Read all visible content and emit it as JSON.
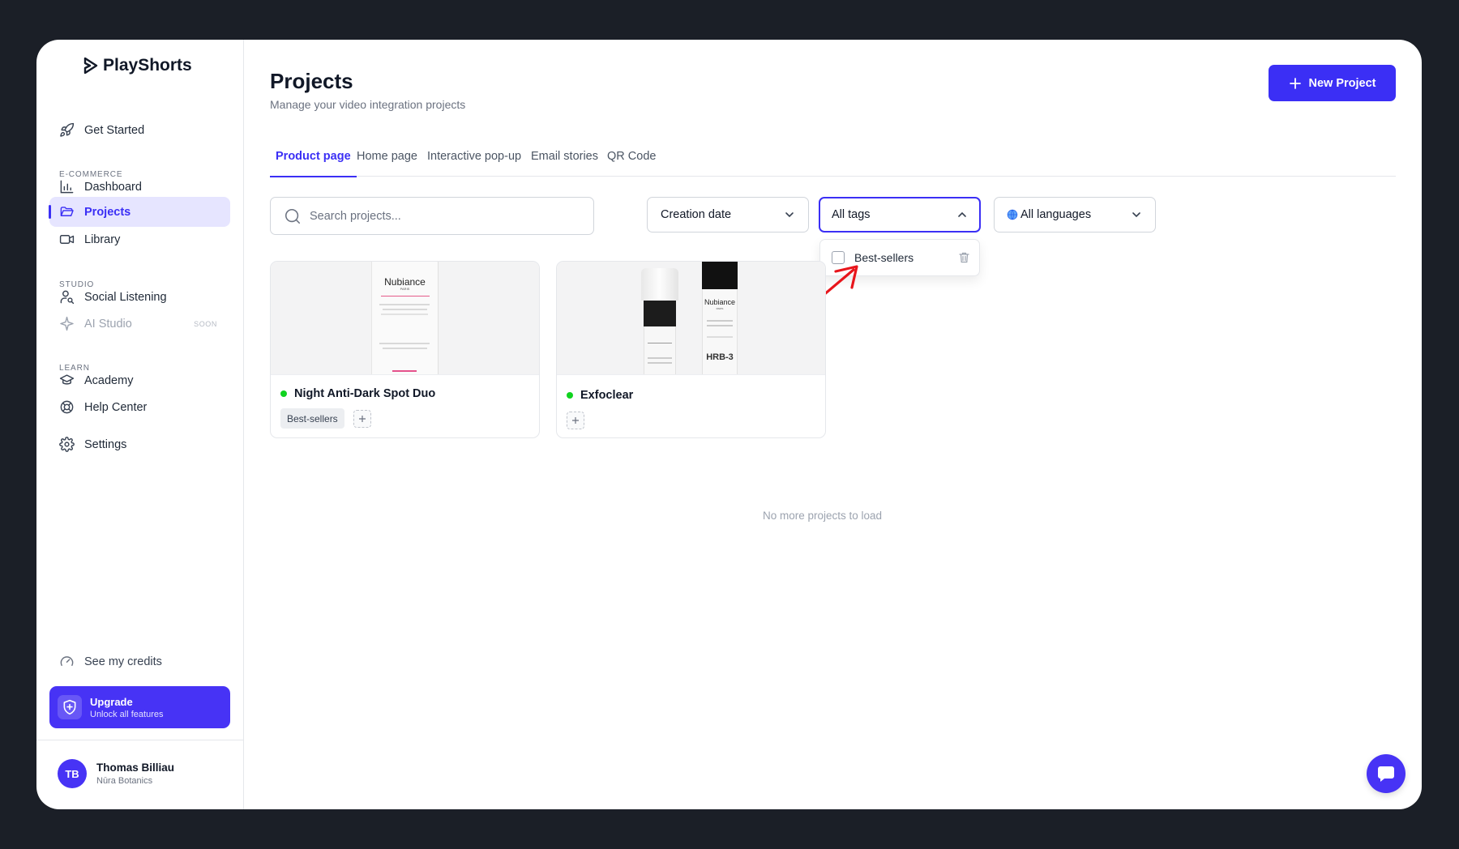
{
  "app": {
    "name": "PlayShorts"
  },
  "sidebar": {
    "get_started": "Get Started",
    "sections": {
      "ecommerce": "E-COMMERCE",
      "studio": "STUDIO",
      "learn": "LEARN"
    },
    "items": {
      "dashboard": "Dashboard",
      "projects": "Projects",
      "library": "Library",
      "social_listening": "Social Listening",
      "ai_studio": "AI Studio",
      "ai_studio_badge": "SOON",
      "academy": "Academy",
      "help_center": "Help Center",
      "settings": "Settings"
    },
    "credits": "See my credits",
    "upgrade": {
      "title": "Upgrade",
      "subtitle": "Unlock all features"
    },
    "user": {
      "initials": "TB",
      "name": "Thomas Billiau",
      "org": "Nūra Botanics"
    }
  },
  "header": {
    "title": "Projects",
    "subtitle": "Manage your video integration projects",
    "new_project": "New Project"
  },
  "tabs": [
    {
      "label": "Product page",
      "active": true
    },
    {
      "label": "Home page"
    },
    {
      "label": "Interactive pop-up"
    },
    {
      "label": "Email stories"
    },
    {
      "label": "QR Code"
    }
  ],
  "filters": {
    "search_placeholder": "Search projects...",
    "sort": "Creation date",
    "tags": "All tags",
    "languages": "All languages",
    "tag_options": [
      {
        "label": "Best-sellers",
        "checked": false
      }
    ]
  },
  "projects": [
    {
      "name": "Night Anti-Dark Spot Duo",
      "status": "active",
      "tags": [
        "Best-sellers"
      ],
      "brand": "Nubiance",
      "brand_sub": "PARIS"
    },
    {
      "name": "Exfoclear",
      "status": "active",
      "tags": [],
      "brand": "Nubiance",
      "brand_sub": "PARIS",
      "product_code": "HRB-3"
    }
  ],
  "empty_message": "No more projects to load",
  "colors": {
    "accent": "#3b2ff5",
    "active_dot": "#10d31f",
    "annotation_arrow": "#e8151b"
  }
}
